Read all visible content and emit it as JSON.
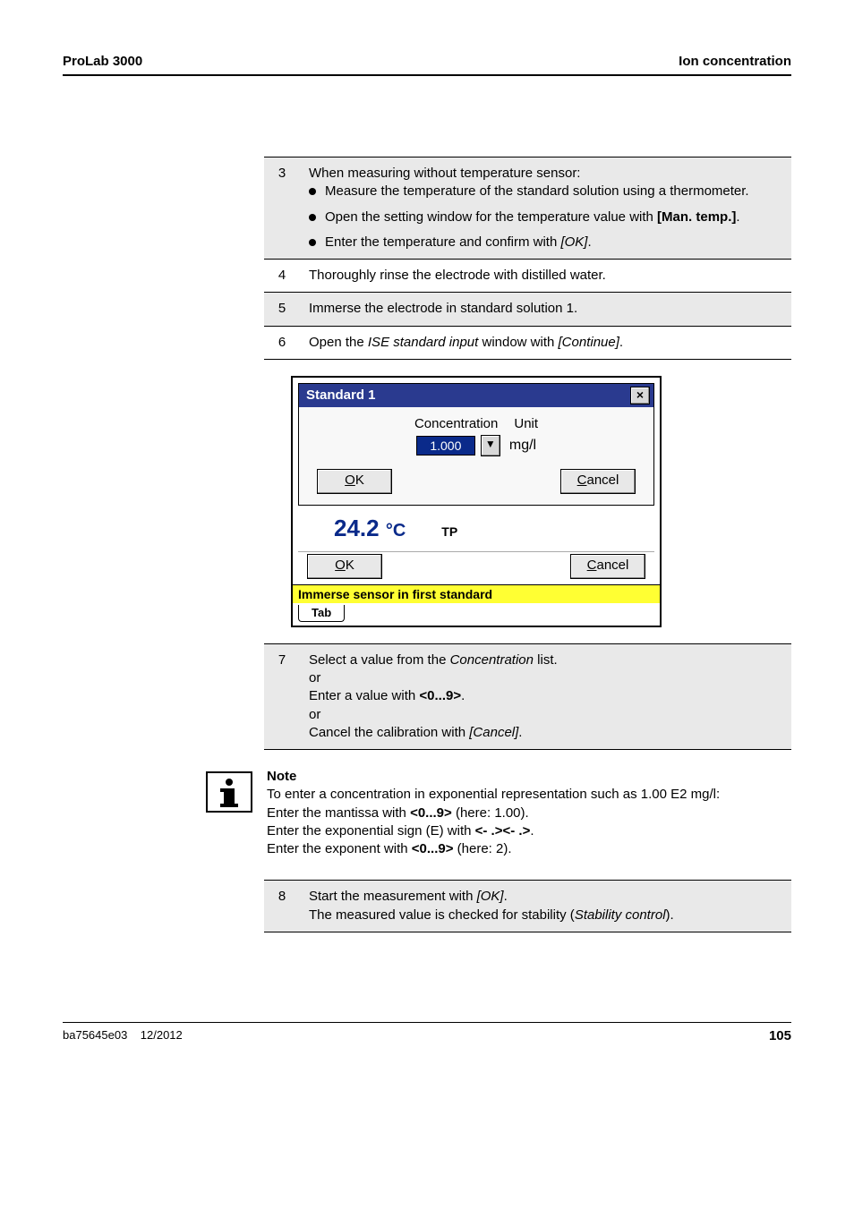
{
  "header": {
    "left": "ProLab 3000",
    "right": "Ion concentration"
  },
  "steps": {
    "s3": {
      "num": "3",
      "intro": "When measuring without temperature sensor:",
      "b1": "Measure the temperature of the standard solution using a thermometer.",
      "b2a": "Open the setting window for the temperature value with ",
      "b2b": "[Man. temp.]",
      "b2c": ".",
      "b3a": "Enter the temperature and confirm with ",
      "b3b": "[OK]",
      "b3c": "."
    },
    "s4": {
      "num": "4",
      "text": "Thoroughly rinse the electrode with distilled water."
    },
    "s5": {
      "num": "5",
      "text": "Immerse the electrode in standard solution 1."
    },
    "s6": {
      "num": "6",
      "a": "Open the ",
      "b": "ISE standard input",
      "c": " window with ",
      "d": "[Continue]",
      "e": "."
    },
    "s7": {
      "num": "7",
      "l1a": "Select a value from the ",
      "l1b": "Concentration",
      "l1c": " list.",
      "l2": "or",
      "l3a": "Enter a value with ",
      "l3b": "<0...9>",
      "l3c": ".",
      "l4": "or",
      "l5a": "Cancel the calibration with ",
      "l5b": "[Cancel]",
      "l5c": "."
    },
    "s8": {
      "num": "8",
      "l1a": "Start the measurement with ",
      "l1b": "[OK]",
      "l1c": ".",
      "l2a": "The measured value is checked for stability (",
      "l2b": "Stability control",
      "l2c": ")."
    }
  },
  "dialog": {
    "title": "Standard 1",
    "close": "×",
    "conc_label": "Concentration",
    "unit_label": "Unit",
    "conc_value": "1.000",
    "dropdown_glyph": "▼",
    "unit_value": "mg/l",
    "ok_u": "O",
    "ok_rest": "K",
    "cancel_u": "C",
    "cancel_rest": "ancel",
    "temp_value": "24.2 ",
    "temp_unit": "°C",
    "tp": "TP",
    "status": "Immerse sensor in first standard",
    "tab": "Tab"
  },
  "note": {
    "title": "Note",
    "l1": "To enter a concentration in exponential representation such as 1.00 E2 mg/l:",
    "l2a": "Enter the mantissa with ",
    "l2b": "<0...9>",
    "l2c": " (here: 1.00).",
    "l3a": "Enter the exponential sign (E) with ",
    "l3b": "<- .><- .>",
    "l3c": ".",
    "l4a": "Enter the exponent with ",
    "l4b": "<0...9>",
    "l4c": " (here: 2)."
  },
  "footer": {
    "doc": "ba75645e03",
    "date": "12/2012",
    "page": "105"
  }
}
